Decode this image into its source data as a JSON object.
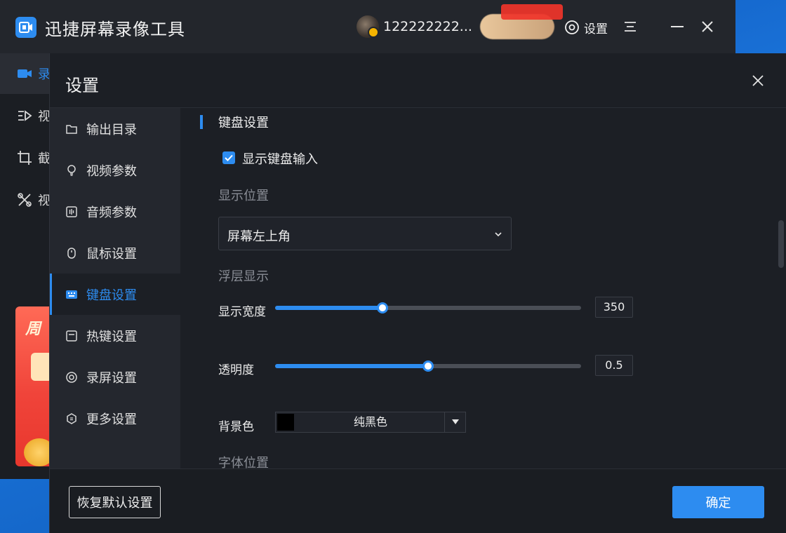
{
  "app": {
    "title": "迅捷屏幕录像工具",
    "username": "122222222...",
    "settings_label": "设置"
  },
  "main_nav": [
    {
      "label": "录",
      "icon": "video-camera-icon"
    },
    {
      "label": "视",
      "icon": "video-list-icon"
    },
    {
      "label": "截",
      "icon": "screenshot-icon"
    },
    {
      "label": "视",
      "icon": "video-tools-icon"
    }
  ],
  "ad": {
    "text": "周"
  },
  "dialog": {
    "title": "设置",
    "nav": [
      {
        "label": "输出目录",
        "icon": "folder-icon"
      },
      {
        "label": "视频参数",
        "icon": "video-param-icon"
      },
      {
        "label": "音频参数",
        "icon": "audio-param-icon"
      },
      {
        "label": "鼠标设置",
        "icon": "mouse-icon"
      },
      {
        "label": "键盘设置",
        "icon": "keyboard-icon",
        "active": true
      },
      {
        "label": "热键设置",
        "icon": "hotkey-icon"
      },
      {
        "label": "录屏设置",
        "icon": "record-icon"
      },
      {
        "label": "更多设置",
        "icon": "more-settings-icon"
      }
    ],
    "keyboard": {
      "section_title": "键盘设置",
      "show_input_label": "显示键盘输入",
      "show_input_checked": true,
      "position_label": "显示位置",
      "position_value": "屏幕左上角",
      "overlay_label": "浮层显示",
      "width_label": "显示宽度",
      "width_value": "350",
      "width_fraction": 0.35,
      "opacity_label": "透明度",
      "opacity_value": "0.5",
      "opacity_fraction": 0.5,
      "bg_label": "背景色",
      "bg_color_name": "纯黑色",
      "bg_color": "#000000",
      "font_position_label": "字体位置"
    },
    "footer": {
      "reset_label": "恢复默认设置",
      "ok_label": "确定"
    }
  },
  "colors": {
    "accent": "#2d8cf0",
    "window_bg": "#1c1f25",
    "sidebar_bg": "#24272e"
  }
}
